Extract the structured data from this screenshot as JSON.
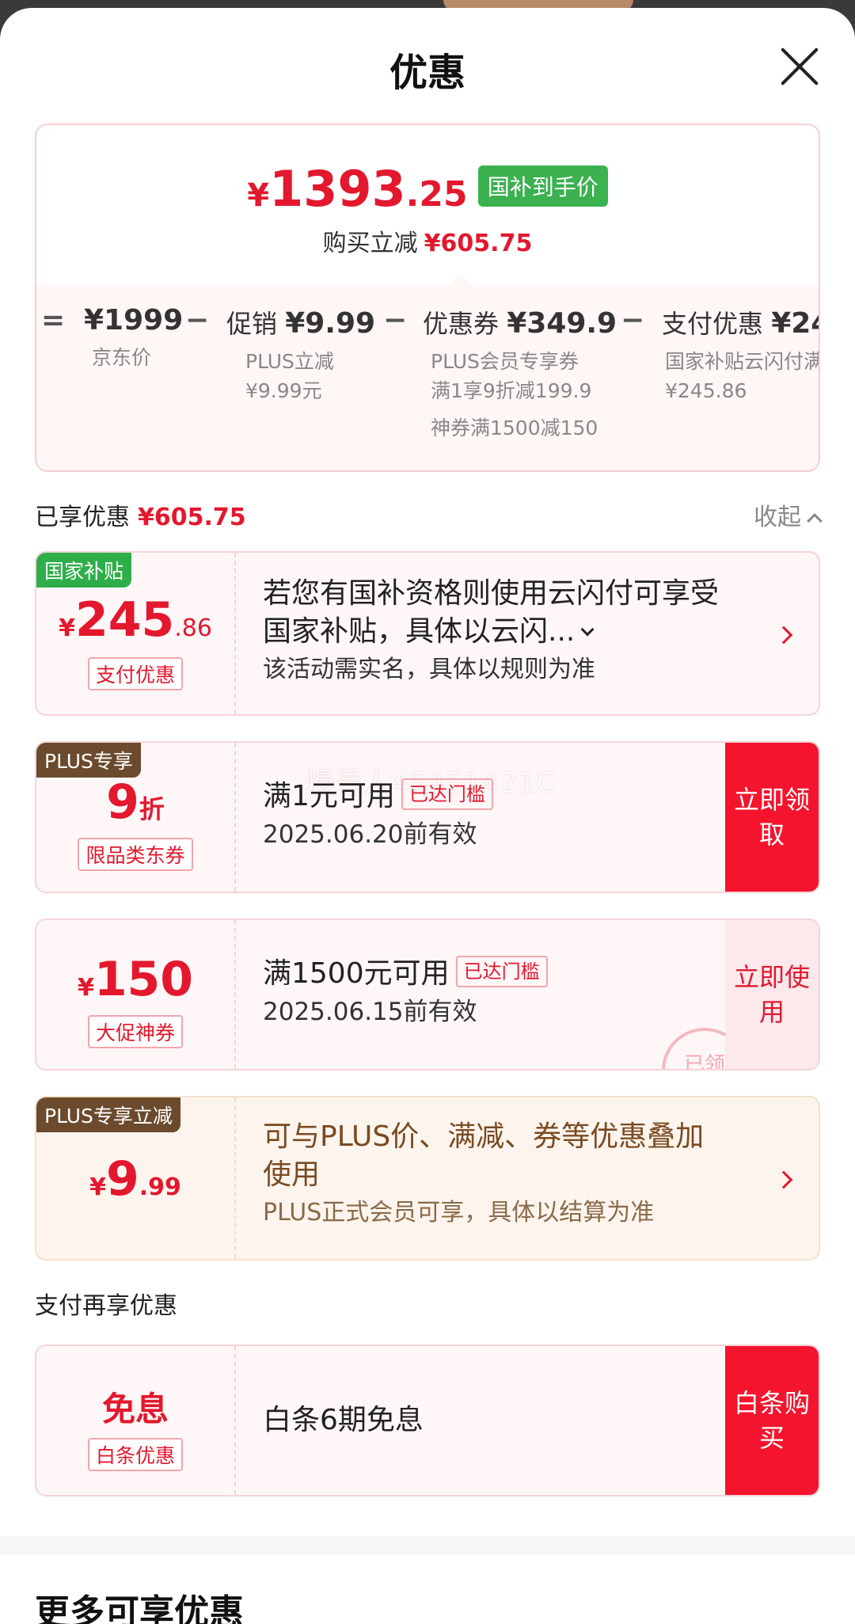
{
  "header": {
    "title": "优惠"
  },
  "summary": {
    "price_yen": "¥",
    "price_int": "1393",
    "price_dec": ".25",
    "price_tag": "国补到手价",
    "save_label": "购买立减",
    "save_value": "¥605.75",
    "breakdown": [
      {
        "op": "=",
        "main": "¥1999",
        "main_label": "",
        "sub": [
          "京东价"
        ]
      },
      {
        "op": "−",
        "main": "¥9.99",
        "main_label": "促销",
        "sub": [
          "PLUS立减",
          "¥9.99元"
        ]
      },
      {
        "op": "−",
        "main": "¥349.9",
        "main_label": "优惠券",
        "sub": [
          "PLUS会员专享券",
          "满1享9折减199.9",
          "神券满1500减150"
        ]
      },
      {
        "op": "−",
        "main": "¥24",
        "main_label": "支付优惠",
        "sub": [
          "国家补贴云闪付满",
          "¥245.86"
        ]
      }
    ]
  },
  "enjoyed": {
    "label": "已享优惠",
    "value": "¥605.75",
    "collapse": "收起"
  },
  "cards": {
    "subsidy": {
      "badge": "国家补贴",
      "yen": "¥",
      "amount": "245",
      "dec": ".86",
      "pill": "支付优惠",
      "line1": "若您有国补资格则使用云闪付可享受",
      "line2": "国家补贴，具体以云闪...",
      "line3": "该活动需实名，具体以规则为准"
    },
    "plus_coupon": {
      "badge": "PLUS专享",
      "amount": "9",
      "unit": "折",
      "pill": "限品类东券",
      "cond": "满1元可用",
      "met": "已达门槛",
      "date": "2025.06.20前有效",
      "action": "立即领取",
      "watermark": "慢是人45451421C"
    },
    "shen_coupon": {
      "yen": "¥",
      "amount": "150",
      "pill": "大促神券",
      "cond": "满1500元可用",
      "met": "已达门槛",
      "date": "2025.06.15前有效",
      "action": "立即使用",
      "stamp": "已领"
    },
    "plus_discount": {
      "badge": "PLUS专享立减",
      "yen": "¥",
      "amount": "9",
      "dec": ".99",
      "line1": "可与PLUS价、满减、券等优惠叠加",
      "line2": "使用",
      "line3": "PLUS正式会员可享，具体以结算为准"
    },
    "baitiao": {
      "amount": "免息",
      "pill": "白条优惠",
      "desc": "白条6期免息",
      "action": "白条购买"
    }
  },
  "pay_section": {
    "title": "支付再享优惠"
  },
  "more_section": {
    "title": "更多可享优惠"
  }
}
